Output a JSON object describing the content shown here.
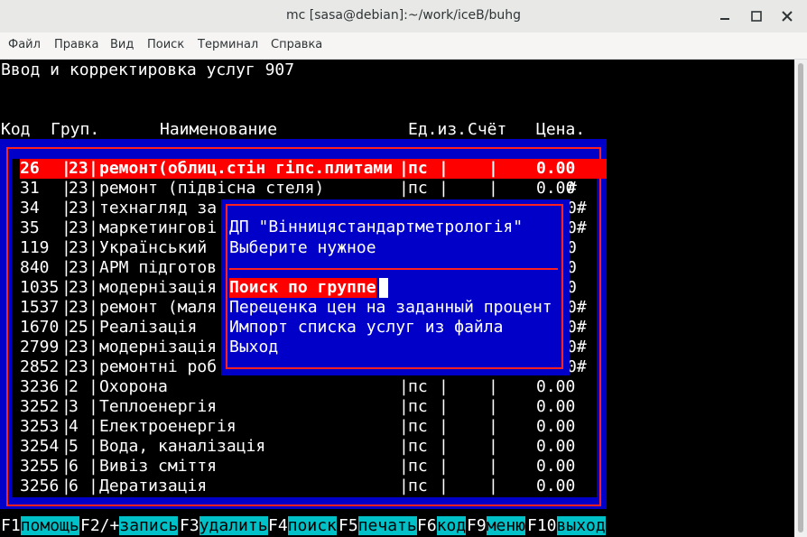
{
  "window": {
    "title": "mc [sasa@debian]:~/work/iceB/buhg"
  },
  "menu": [
    "Файл",
    "Правка",
    "Вид",
    "Поиск",
    "Терминал",
    "Справка"
  ],
  "screen": {
    "heading": "Ввод и корректировка услуг 907",
    "columns": {
      "code": "Код",
      "group": "Груп.",
      "name": "Наименование",
      "unit": "Ед.из.",
      "account": "Счёт",
      "price": "Цена."
    }
  },
  "rows": [
    {
      "code": "26",
      "group": "23",
      "name": "ремонт(облиц.стін гіпс.плитами",
      "unit": "пс",
      "price": "0.00",
      "mark": "",
      "selected": true
    },
    {
      "code": "31",
      "group": "23",
      "name": "ремонт (підвісна стеля)",
      "unit": "пс",
      "price": "0.00",
      "mark": "#"
    },
    {
      "code": "34",
      "group": "23",
      "name": "технагляд за",
      "unit": "",
      "price": "",
      "mark": "0#"
    },
    {
      "code": "35",
      "group": "23",
      "name": "маркетингові",
      "unit": "",
      "price": "",
      "mark": "0#"
    },
    {
      "code": "119",
      "group": "23",
      "name": "Український",
      "unit": "",
      "price": "",
      "mark": "0"
    },
    {
      "code": "840",
      "group": "23",
      "name": "АРМ підготов",
      "unit": "",
      "price": "",
      "mark": "0"
    },
    {
      "code": "1035",
      "group": "23",
      "name": "модернізація",
      "unit": "",
      "price": "",
      "mark": "0"
    },
    {
      "code": "1537",
      "group": "23",
      "name": "ремонт (маля",
      "unit": "",
      "price": "",
      "mark": "0#"
    },
    {
      "code": "1670",
      "group": "25",
      "name": "Реалізація",
      "unit": "",
      "price": "",
      "mark": "0#"
    },
    {
      "code": "2799",
      "group": "23",
      "name": "модернізація",
      "unit": "",
      "price": "",
      "mark": "0#"
    },
    {
      "code": "2852",
      "group": "23",
      "name": "ремонтні роб",
      "unit": "",
      "price": "",
      "mark": "0#"
    },
    {
      "code": "3236",
      "group": "2",
      "name": "Охорона",
      "unit": "пс",
      "price": "0.00",
      "mark": ""
    },
    {
      "code": "3252",
      "group": "3",
      "name": "Теплоенергія",
      "unit": "пс",
      "price": "0.00",
      "mark": ""
    },
    {
      "code": "3253",
      "group": "4",
      "name": "Електроенергія",
      "unit": "пс",
      "price": "0.00",
      "mark": ""
    },
    {
      "code": "3254",
      "group": "5",
      "name": "Вода, каналізація",
      "unit": "пс",
      "price": "0.00",
      "mark": ""
    },
    {
      "code": "3255",
      "group": "6",
      "name": "Вивіз сміття",
      "unit": "пс",
      "price": "0.00",
      "mark": ""
    },
    {
      "code": "3256",
      "group": "6",
      "name": "Дератизація",
      "unit": "пс",
      "price": "0.00",
      "mark": ""
    }
  ],
  "dialog": {
    "org": "ДП \"Вінницястандартметрологія\"",
    "prompt": "Выберите нужное",
    "options": [
      {
        "label": "Поиск по группе",
        "selected": true
      },
      {
        "label": "Переценка цен на заданный процент"
      },
      {
        "label": "Импорт списка услуг из файла"
      },
      {
        "label": "Выход"
      }
    ]
  },
  "fkeys": [
    {
      "key": "F1",
      "label": "помощь"
    },
    {
      "key": "F2/+",
      "label": "запись"
    },
    {
      "key": "F3",
      "label": "удалить"
    },
    {
      "key": "F4",
      "label": "поиск"
    },
    {
      "key": "F5",
      "label": "печать"
    },
    {
      "key": "F6",
      "label": "код"
    },
    {
      "key": "F9",
      "label": "меню"
    },
    {
      "key": "F10",
      "label": "выход"
    }
  ],
  "colors": {
    "panel": "#0000c8",
    "frame": "#ff2020",
    "highlight": "#ff0000",
    "fkey_label": "#00c0c8"
  }
}
